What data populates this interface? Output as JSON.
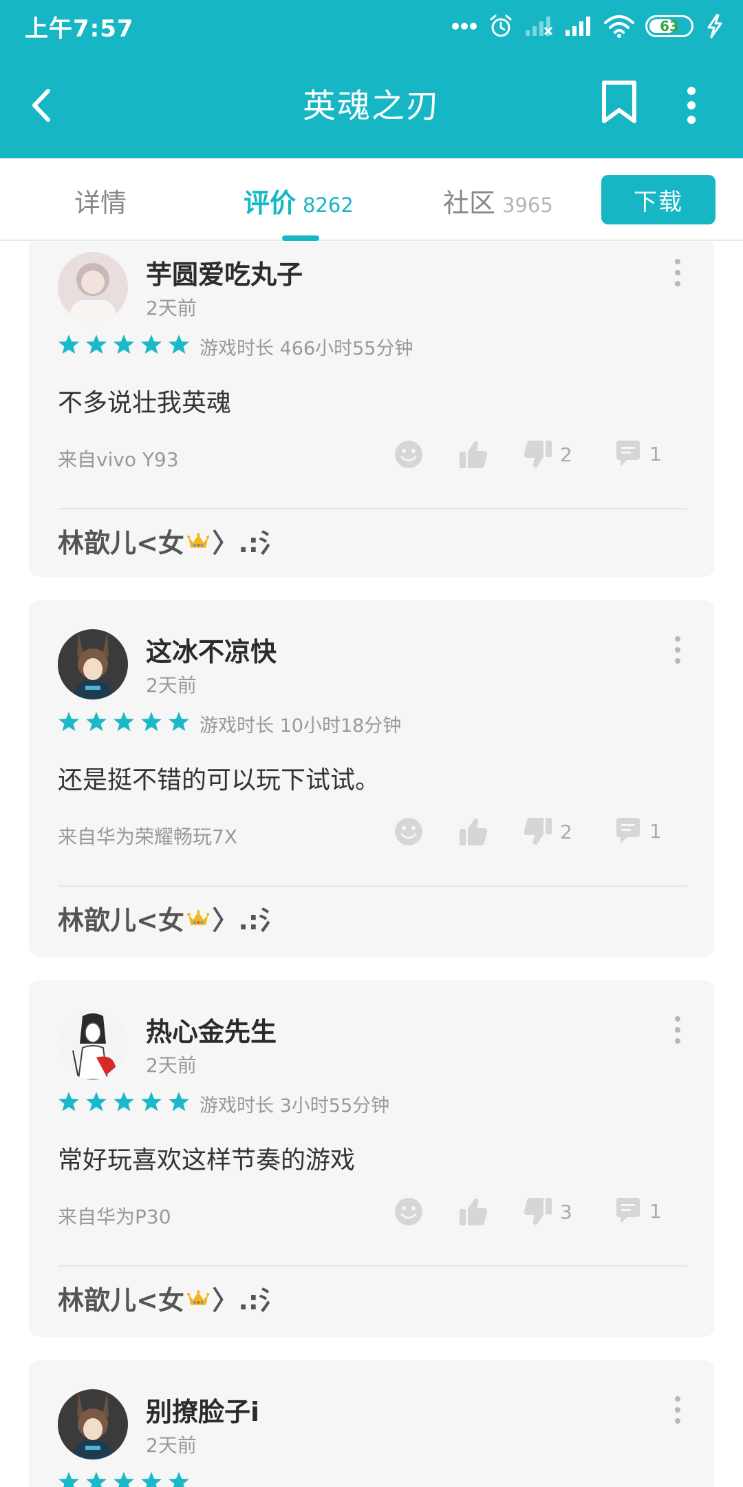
{
  "status_bar": {
    "time": "上午7:57",
    "battery_level": 63,
    "battery_text": "63"
  },
  "toolbar": {
    "back_icon": "back-arrow-icon",
    "title": "英魂之刃",
    "bookmark_icon": "bookmark-icon",
    "more_icon": "more-vertical-icon"
  },
  "tabs": [
    {
      "label": "详情",
      "count": ""
    },
    {
      "label": "评价",
      "count": "8262"
    },
    {
      "label": "社区",
      "count": "3965"
    }
  ],
  "download_label": "下载",
  "reviews": [
    {
      "username": "芋圆爱吃丸子",
      "time": "2天前",
      "rating": 5,
      "playtime": "游戏时长 466小时55分钟",
      "text": "不多说壮我英魂",
      "device": "来自vivo Y93",
      "dislikes": "2",
      "comments": "1",
      "reply_name": "林歆儿<女",
      "reply_tail": "〉.:氵"
    },
    {
      "username": "这冰不凉快",
      "time": "2天前",
      "rating": 5,
      "playtime": "游戏时长 10小时18分钟",
      "text": "还是挺不错的可以玩下试试。",
      "device": "来自华为荣耀畅玩7X",
      "dislikes": "2",
      "comments": "1",
      "reply_name": "林歆儿<女",
      "reply_tail": "〉.:氵"
    },
    {
      "username": "热心金先生",
      "time": "2天前",
      "rating": 5,
      "playtime": "游戏时长 3小时55分钟",
      "text": "常好玩喜欢这样节奏的游戏",
      "device": "来自华为P30",
      "dislikes": "3",
      "comments": "1",
      "reply_name": "林歆儿<女",
      "reply_tail": "〉.:氵"
    },
    {
      "username": "别撩脸子i",
      "time": "2天前",
      "rating": 5
    }
  ],
  "colors": {
    "accent": "#16b6c5",
    "star": "#1ab8c8",
    "card_bg": "#f6f6f6"
  }
}
